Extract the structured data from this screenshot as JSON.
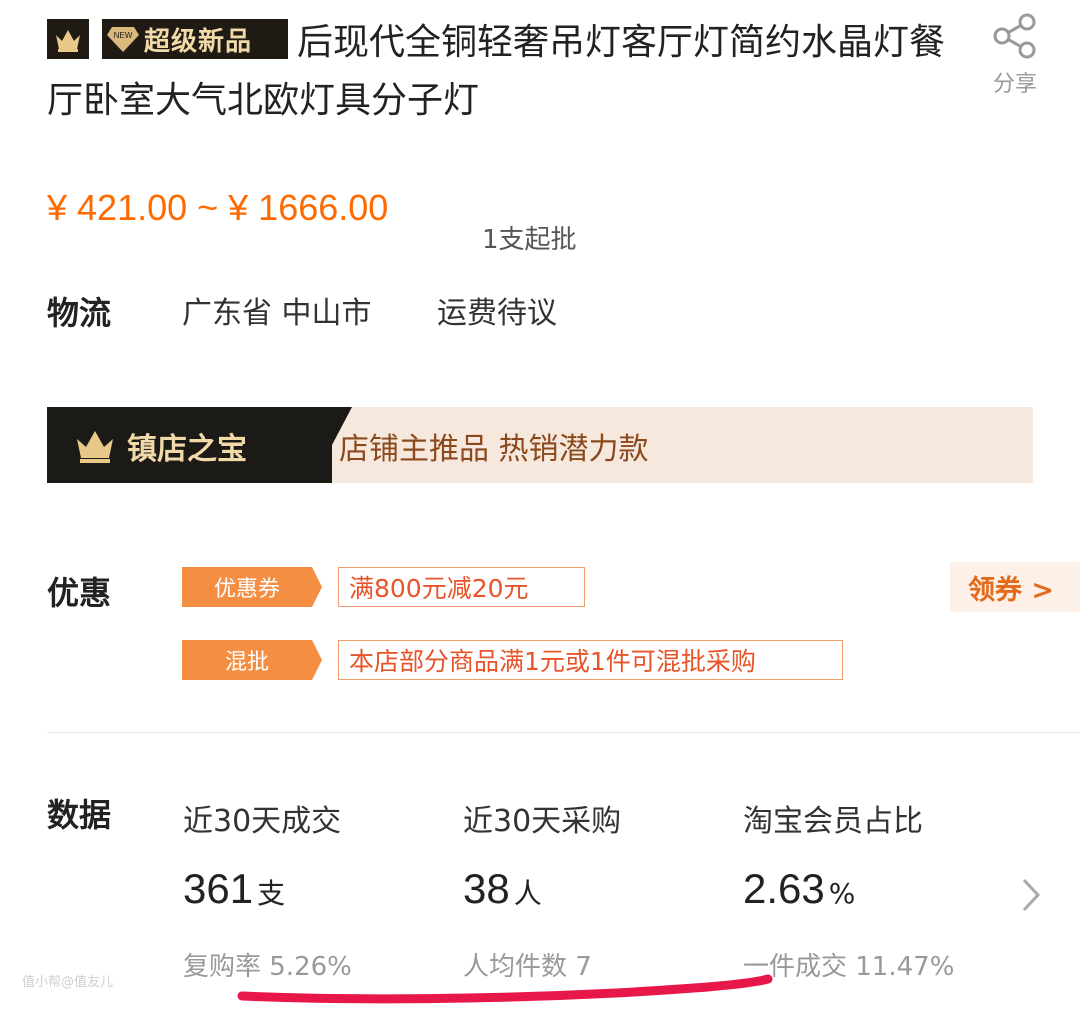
{
  "product": {
    "badge": "超级新品",
    "new_tag": "NEW",
    "title": "后现代全铜轻奢吊灯客厅灯简约水晶灯餐厅卧室大气北欧灯具分子灯",
    "share_label": "分享"
  },
  "price": {
    "range": "¥ 421.00 ~ ¥ 1666.00",
    "moq": "1支起批"
  },
  "logistics": {
    "label": "物流",
    "location": "广东省 中山市",
    "fee": "运费待议"
  },
  "banner": {
    "name": "镇店之宝",
    "desc": "店铺主推品  热销潜力款"
  },
  "promotions": {
    "label": "优惠",
    "items": [
      {
        "tag": "优惠券",
        "text": "满800元减20元"
      },
      {
        "tag": "混批",
        "text": "本店部分商品满1元或1件可混批采购"
      }
    ],
    "claim": "领券 >"
  },
  "stats": {
    "label": "数据",
    "columns": [
      {
        "title": "近30天成交",
        "value": "361",
        "unit": "支",
        "sub": "复购率 5.26%"
      },
      {
        "title": "近30天采购",
        "value": "38",
        "unit": "人",
        "sub": "人均件数 7"
      },
      {
        "title": "淘宝会员占比",
        "value": "2.63",
        "unit": "%",
        "sub": "一件成交 11.47%"
      }
    ]
  },
  "watermark": "值小帮@值友儿",
  "colors": {
    "price": "#ff6a00",
    "tag": "#f48e43",
    "ticket_text": "#e8542a",
    "underline": "#e8174a",
    "badge_bg": "#1f1a14",
    "badge_text": "#f1d9a8"
  }
}
